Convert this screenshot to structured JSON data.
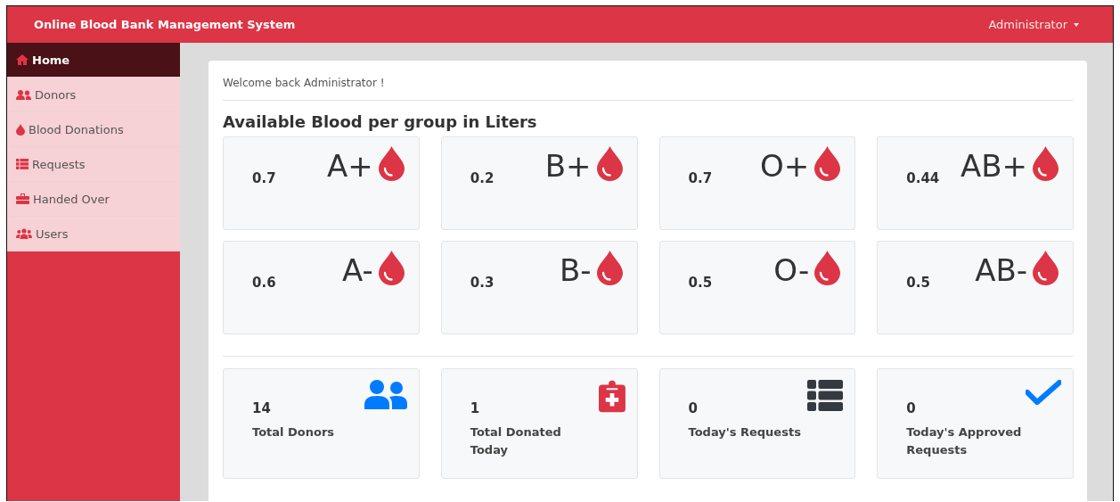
{
  "navbar": {
    "title": "Online Blood Bank Management System",
    "user_menu": "Administrator"
  },
  "sidebar": {
    "items": [
      {
        "label": "Home",
        "selected": true
      },
      {
        "label": "Donors",
        "selected": false
      },
      {
        "label": "Blood Donations",
        "selected": false
      },
      {
        "label": "Requests",
        "selected": false
      },
      {
        "label": "Handed Over",
        "selected": false
      },
      {
        "label": "Users",
        "selected": false
      }
    ]
  },
  "welcome": "Welcome back Administrator !",
  "blood_heading": "Available Blood per group in Liters",
  "blood_groups": [
    {
      "group": "A+",
      "amount": "0.7"
    },
    {
      "group": "B+",
      "amount": "0.2"
    },
    {
      "group": "O+",
      "amount": "0.7"
    },
    {
      "group": "AB+",
      "amount": "0.44"
    },
    {
      "group": "A-",
      "amount": "0.6"
    },
    {
      "group": "B-",
      "amount": "0.3"
    },
    {
      "group": "O-",
      "amount": "0.5"
    },
    {
      "group": "AB-",
      "amount": "0.5"
    }
  ],
  "stats": [
    {
      "value": "14",
      "label": "Total Donors"
    },
    {
      "value": "1",
      "label": "Total Donated Today"
    },
    {
      "value": "0",
      "label": "Today's Requests"
    },
    {
      "value": "0",
      "label": "Today's Approved Requests"
    }
  ]
}
